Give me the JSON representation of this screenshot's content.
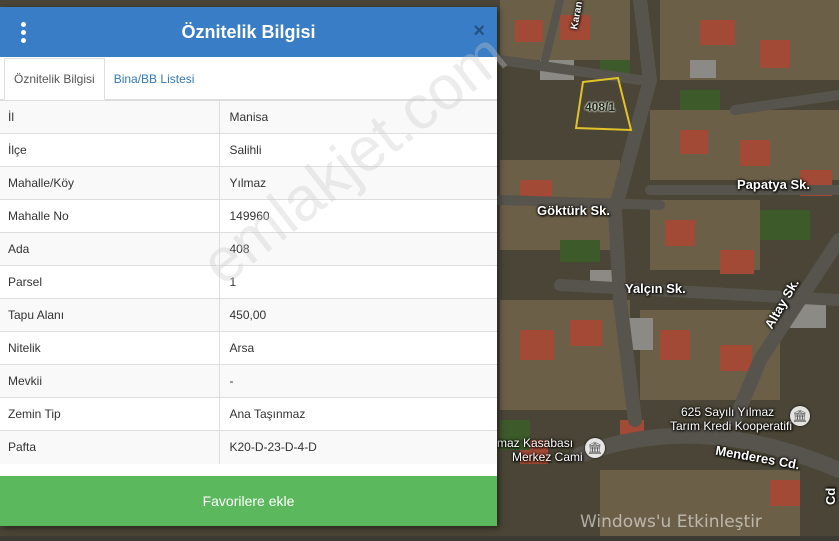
{
  "header": {
    "title": "Öznitelik Bilgisi",
    "close_glyph": "×"
  },
  "tabs": [
    {
      "label": "Öznitelik Bilgisi",
      "active": true
    },
    {
      "label": "Bina/BB Listesi",
      "active": false
    }
  ],
  "attributes": [
    {
      "key": "İl",
      "value": "Manisa"
    },
    {
      "key": "İlçe",
      "value": "Salihli"
    },
    {
      "key": "Mahalle/Köy",
      "value": "Yılmaz"
    },
    {
      "key": "Mahalle No",
      "value": "149960"
    },
    {
      "key": "Ada",
      "value": "408"
    },
    {
      "key": "Parsel",
      "value": "1"
    },
    {
      "key": "Tapu Alanı",
      "value": "450,00"
    },
    {
      "key": "Nitelik",
      "value": "Arsa"
    },
    {
      "key": "Mevkii",
      "value": "-"
    },
    {
      "key": "Zemin Tip",
      "value": "Ana Taşınmaz"
    },
    {
      "key": "Pafta",
      "value": "K20-D-23-D-4-D"
    }
  ],
  "footer": {
    "favorite_label": "Favorilere ekle"
  },
  "map": {
    "parcel_label": "408/1",
    "streets": {
      "papatya": "Papatya Sk.",
      "gokturk": "Göktürk Sk.",
      "yalcin": "Yalçın Sk.",
      "altay": "Altay Sk.",
      "menderes": "Menderes Cd.",
      "karan": "Karan",
      "cd": "Cd"
    },
    "pois": {
      "cooperative_line1": "625 Sayılı Yılmaz",
      "cooperative_line2": "Tarım Kredi Kooperatifi",
      "mosque_line1": "maz Kasabası",
      "mosque_line2": "Merkez Cami"
    }
  },
  "watermarks": {
    "site": "emlakjet.com",
    "os": "Windows'u Etkinleştir"
  },
  "colors": {
    "header_bg": "#3a7dc7",
    "favorite_bg": "#5cb85c",
    "tab_link": "#337ab7"
  },
  "icons": {
    "menu": "kebab-menu-icon",
    "close": "close-icon",
    "poi": "landmark-icon"
  }
}
